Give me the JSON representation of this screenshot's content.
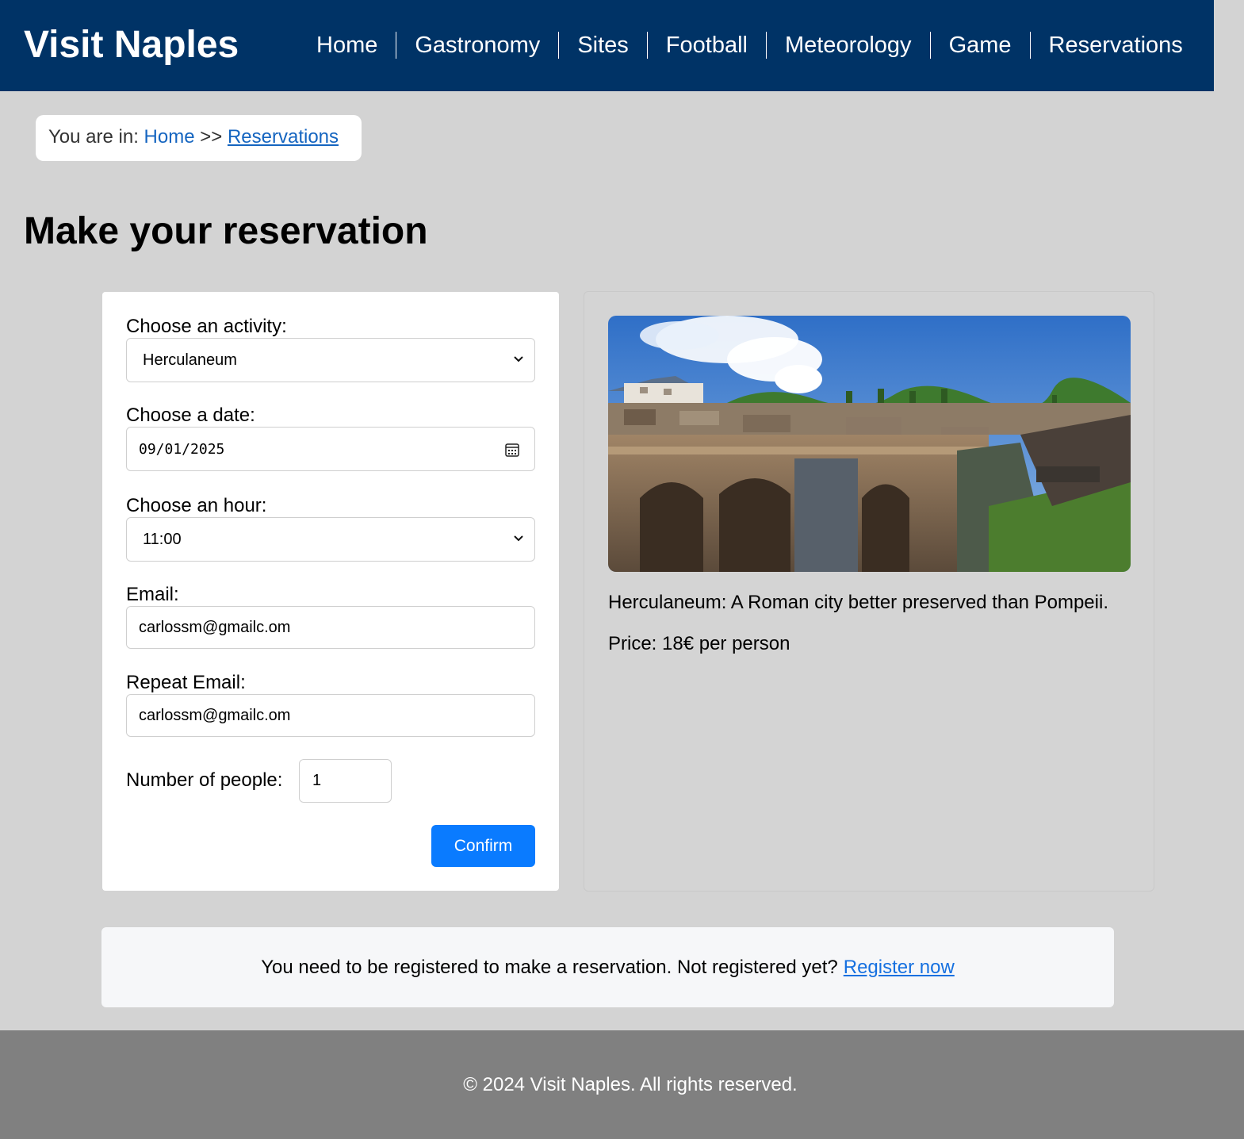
{
  "header": {
    "brand": "Visit Naples",
    "nav": [
      "Home",
      "Gastronomy",
      "Sites",
      "Football",
      "Meteorology",
      "Game",
      "Reservations"
    ]
  },
  "breadcrumb": {
    "prefix": "You are in:",
    "home": "Home",
    "separator": ">>",
    "current": "Reservations"
  },
  "page_title": "Make your reservation",
  "form": {
    "activity_label": "Choose an activity:",
    "activity_value": "Herculaneum",
    "date_label": "Choose a date:",
    "date_value": "09/01/2025",
    "hour_label": "Choose an hour:",
    "hour_value": "11:00",
    "email_label": "Email:",
    "email_value": "carlossm@gmailc.om",
    "repeat_email_label": "Repeat Email:",
    "repeat_email_value": "carlossm@gmailc.om",
    "people_label": "Number of people:",
    "people_value": "1",
    "confirm_label": "Confirm"
  },
  "activity_info": {
    "description": "Herculaneum: A Roman city better preserved than Pompeii.",
    "price": "Price: 18€ per person"
  },
  "notice": {
    "text": "You need to be registered to make a reservation. Not registered yet?",
    "link": "Register now"
  },
  "footer": {
    "text": "© 2024 Visit Naples. All rights reserved."
  },
  "colors": {
    "header_bg": "#003366",
    "page_bg": "#d3d3d3",
    "confirm_bg": "#0a7bff",
    "link": "#1565c0",
    "footer_bg": "#808080"
  }
}
